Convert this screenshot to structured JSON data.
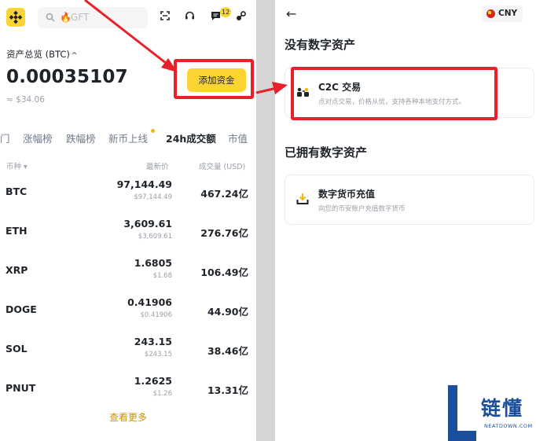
{
  "left": {
    "search": {
      "placeholder": "GFT"
    },
    "header_badge": "12",
    "asset_label": "资产总览 (BTC)",
    "balance": "0.00035107",
    "fiat": "≈ $34.06",
    "add_funds_button": "添加资金",
    "tabs": [
      "门",
      "涨幅榜",
      "跌幅榜",
      "新币上线",
      "24h成交额",
      "市值"
    ],
    "active_tab": "24h成交额",
    "table": {
      "headers": {
        "coin": "币种",
        "price": "最新价",
        "volume": "成交量 (USD)"
      },
      "rows": [
        {
          "coin": "BTC",
          "price": "97,144.49",
          "price_fiat": "$97,144.49",
          "volume": "467.24亿"
        },
        {
          "coin": "ETH",
          "price": "3,609.61",
          "price_fiat": "$3,609.61",
          "volume": "276.76亿"
        },
        {
          "coin": "XRP",
          "price": "1.6805",
          "price_fiat": "$1.68",
          "volume": "106.49亿"
        },
        {
          "coin": "DOGE",
          "price": "0.41906",
          "price_fiat": "$0.41906",
          "volume": "44.90亿"
        },
        {
          "coin": "SOL",
          "price": "243.15",
          "price_fiat": "$243.15",
          "volume": "38.46亿"
        },
        {
          "coin": "PNUT",
          "price": "1.2625",
          "price_fiat": "$1.26",
          "volume": "13.31亿"
        }
      ]
    },
    "view_more": "查看更多"
  },
  "right": {
    "currency": "CNY",
    "section_no_assets": "没有数字资产",
    "c2c": {
      "title": "C2C 交易",
      "desc": "点对点交易，价格从优，支持各种本地支付方式。"
    },
    "section_has_assets": "已拥有数字资产",
    "deposit": {
      "title": "数字货币充值",
      "desc": "向您的币安账户充值数字货币"
    }
  },
  "watermark": {
    "brand": "链懂",
    "domain": "NEATDOWN.COM"
  },
  "colors": {
    "brand_yellow": "#fcd535",
    "annotation_red": "#e8202a",
    "watermark_blue": "#1b4e9b"
  },
  "icons": [
    "binance-logo-icon",
    "search-icon",
    "scan-icon",
    "headset-icon",
    "chat-icon",
    "settings-icon",
    "back-arrow-icon",
    "cny-flag-icon",
    "c2c-icon",
    "deposit-icon"
  ]
}
